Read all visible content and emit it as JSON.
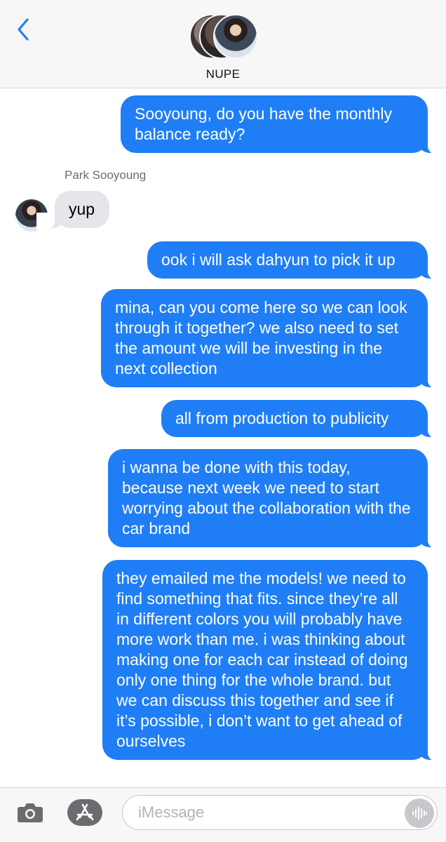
{
  "header": {
    "back_icon": "chevron-left-icon",
    "conversation_name": "NUPE"
  },
  "messages": [
    {
      "direction": "outgoing",
      "text": "Sooyoung, do you have the monthly balance ready?"
    },
    {
      "direction": "incoming",
      "sender": "Park Sooyoung",
      "text": "yup"
    },
    {
      "direction": "outgoing",
      "text": "ook i will ask dahyun to pick it up"
    },
    {
      "direction": "outgoing",
      "text": "mina, can you come here so we can look through it together? we also need to set the amount we will be investing in the next collection"
    },
    {
      "direction": "outgoing",
      "text": "all from production to publicity"
    },
    {
      "direction": "outgoing",
      "text": "i wanna be done with this today, because next week we need to start worrying about the collaboration with the car brand"
    },
    {
      "direction": "outgoing",
      "text": "they emailed me the models! we need to find something that fits. since they’re all in different colors you will probably have more work than me. i was thinking about making one for each car instead of doing only one thing for the whole brand. but we can discuss this together and see if it’s possible, i don’t want to get ahead of ourselves"
    }
  ],
  "input_bar": {
    "camera_icon": "camera-icon",
    "apps_icon": "app-store-icon",
    "placeholder": "iMessage",
    "audio_icon": "audio-waveform-icon"
  },
  "colors": {
    "outgoing_bubble": "#1f7ef5",
    "incoming_bubble": "#e5e5ea",
    "accent": "#1f7ef5"
  }
}
